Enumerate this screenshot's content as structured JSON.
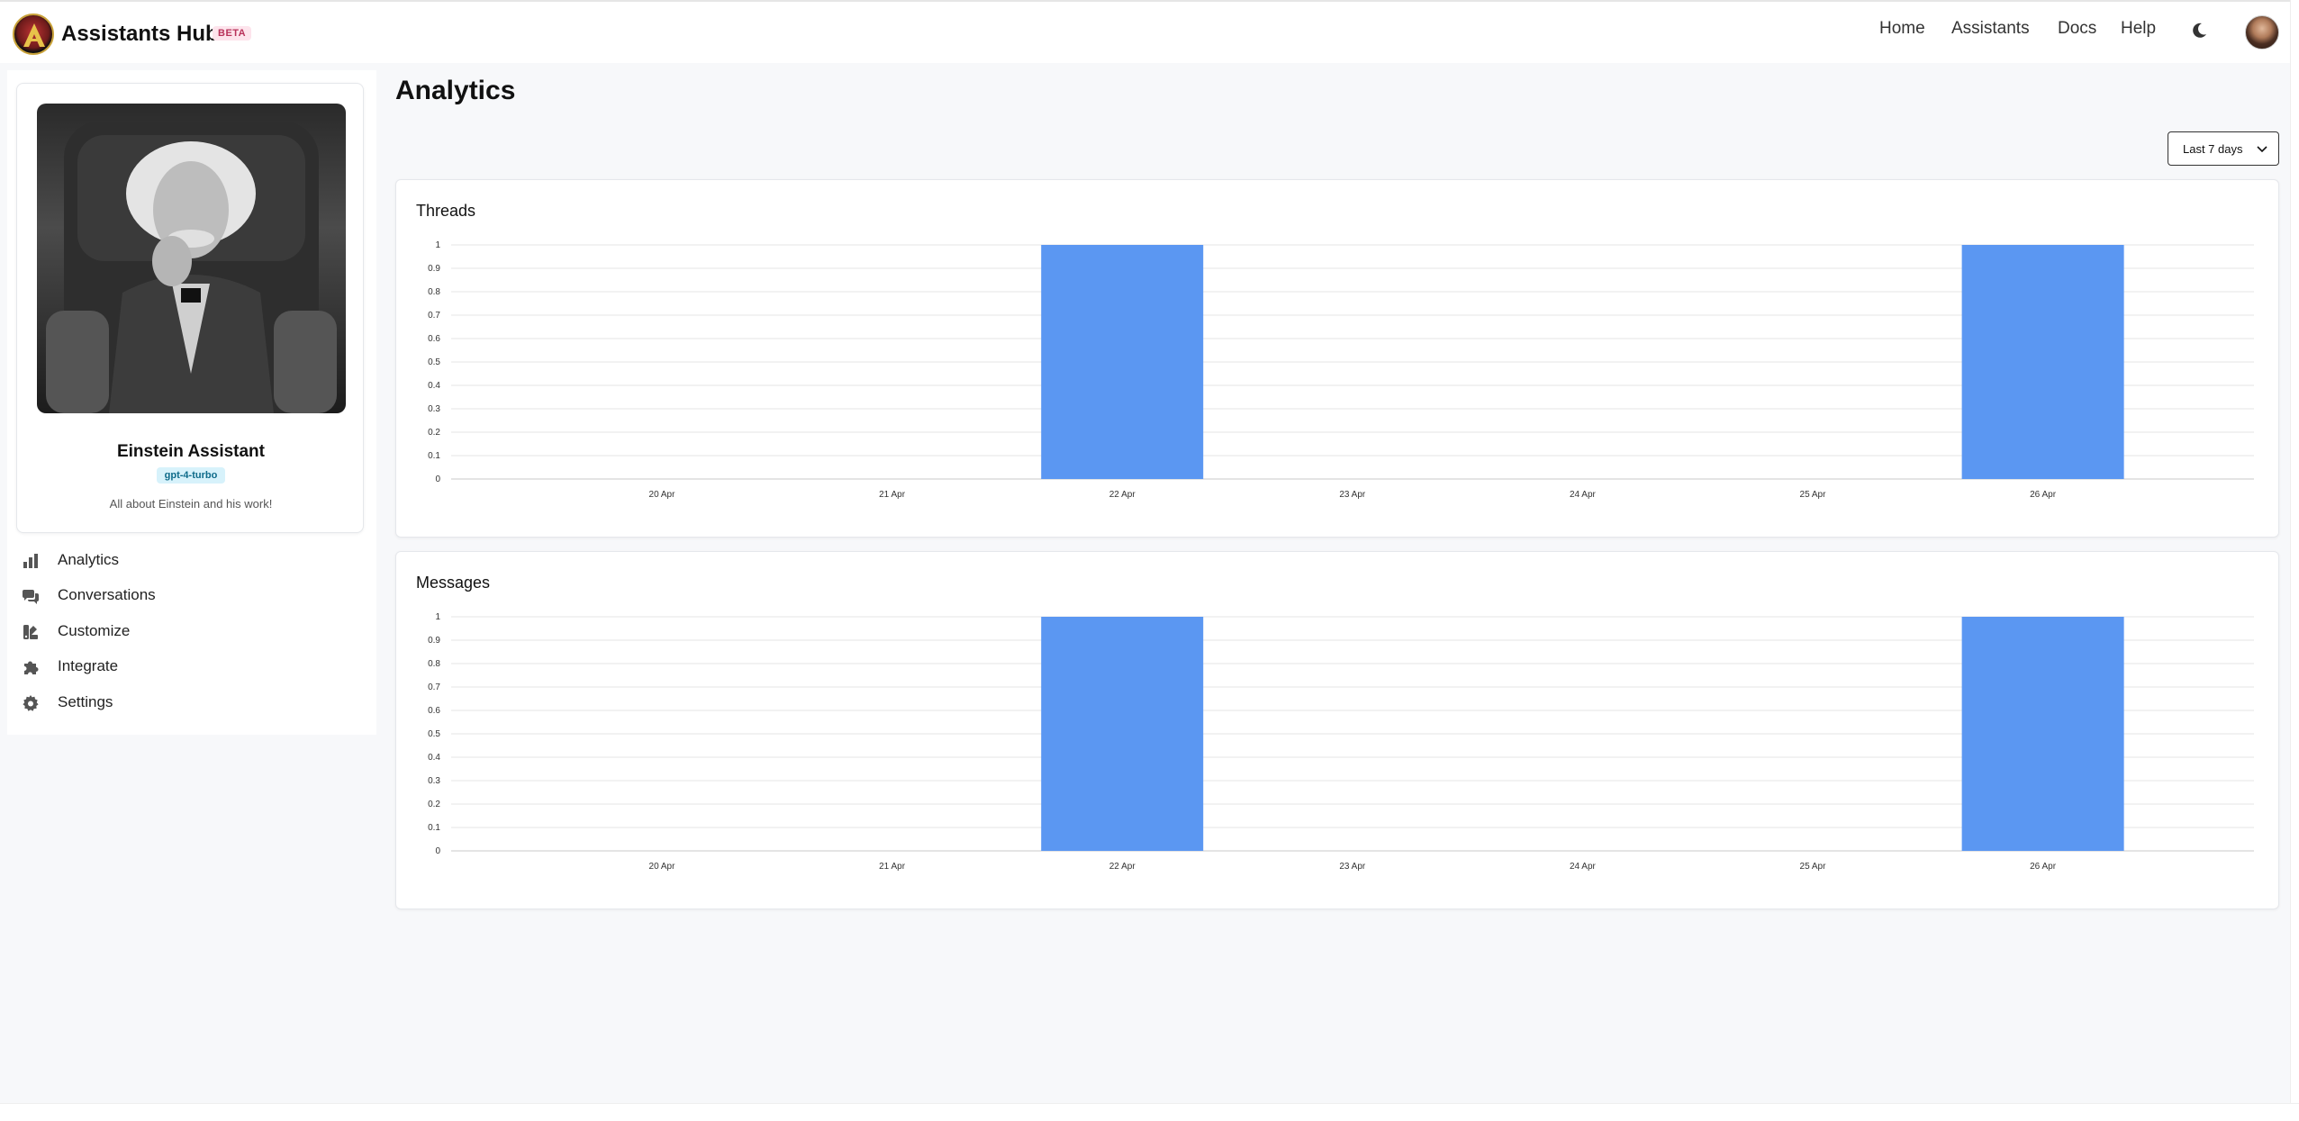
{
  "header": {
    "brand": "Assistants Hub",
    "badge": "BETA",
    "nav": [
      "Home",
      "Assistants",
      "Docs",
      "Help"
    ]
  },
  "assistant": {
    "name": "Einstein Assistant",
    "model": "gpt-4-turbo",
    "description": "All about Einstein and his work!"
  },
  "sidebar": {
    "items": [
      {
        "label": "Analytics",
        "icon": "bar-chart-icon"
      },
      {
        "label": "Conversations",
        "icon": "chat-bubbles-icon"
      },
      {
        "label": "Customize",
        "icon": "palette-icon"
      },
      {
        "label": "Integrate",
        "icon": "puzzle-icon"
      },
      {
        "label": "Settings",
        "icon": "gear-icon"
      }
    ]
  },
  "main": {
    "title": "Analytics",
    "range_label": "Last 7 days"
  },
  "colors": {
    "bar": "#5b97f2",
    "accent": "#0e6b8a"
  },
  "chart_data": [
    {
      "type": "bar",
      "title": "Threads",
      "categories": [
        "20 Apr",
        "21 Apr",
        "22 Apr",
        "23 Apr",
        "24 Apr",
        "25 Apr",
        "26 Apr"
      ],
      "values": [
        0,
        0,
        1,
        0,
        0,
        0,
        1
      ],
      "ylim": [
        0,
        1
      ],
      "yticks": [
        "0",
        "0.1",
        "0.2",
        "0.3",
        "0.4",
        "0.5",
        "0.6",
        "0.7",
        "0.8",
        "0.9",
        "1"
      ],
      "grid": true
    },
    {
      "type": "bar",
      "title": "Messages",
      "categories": [
        "20 Apr",
        "21 Apr",
        "22 Apr",
        "23 Apr",
        "24 Apr",
        "25 Apr",
        "26 Apr"
      ],
      "values": [
        0,
        0,
        1,
        0,
        0,
        0,
        1
      ],
      "ylim": [
        0,
        1
      ],
      "yticks": [
        "0",
        "0.1",
        "0.2",
        "0.3",
        "0.4",
        "0.5",
        "0.6",
        "0.7",
        "0.8",
        "0.9",
        "1"
      ],
      "grid": true
    }
  ]
}
